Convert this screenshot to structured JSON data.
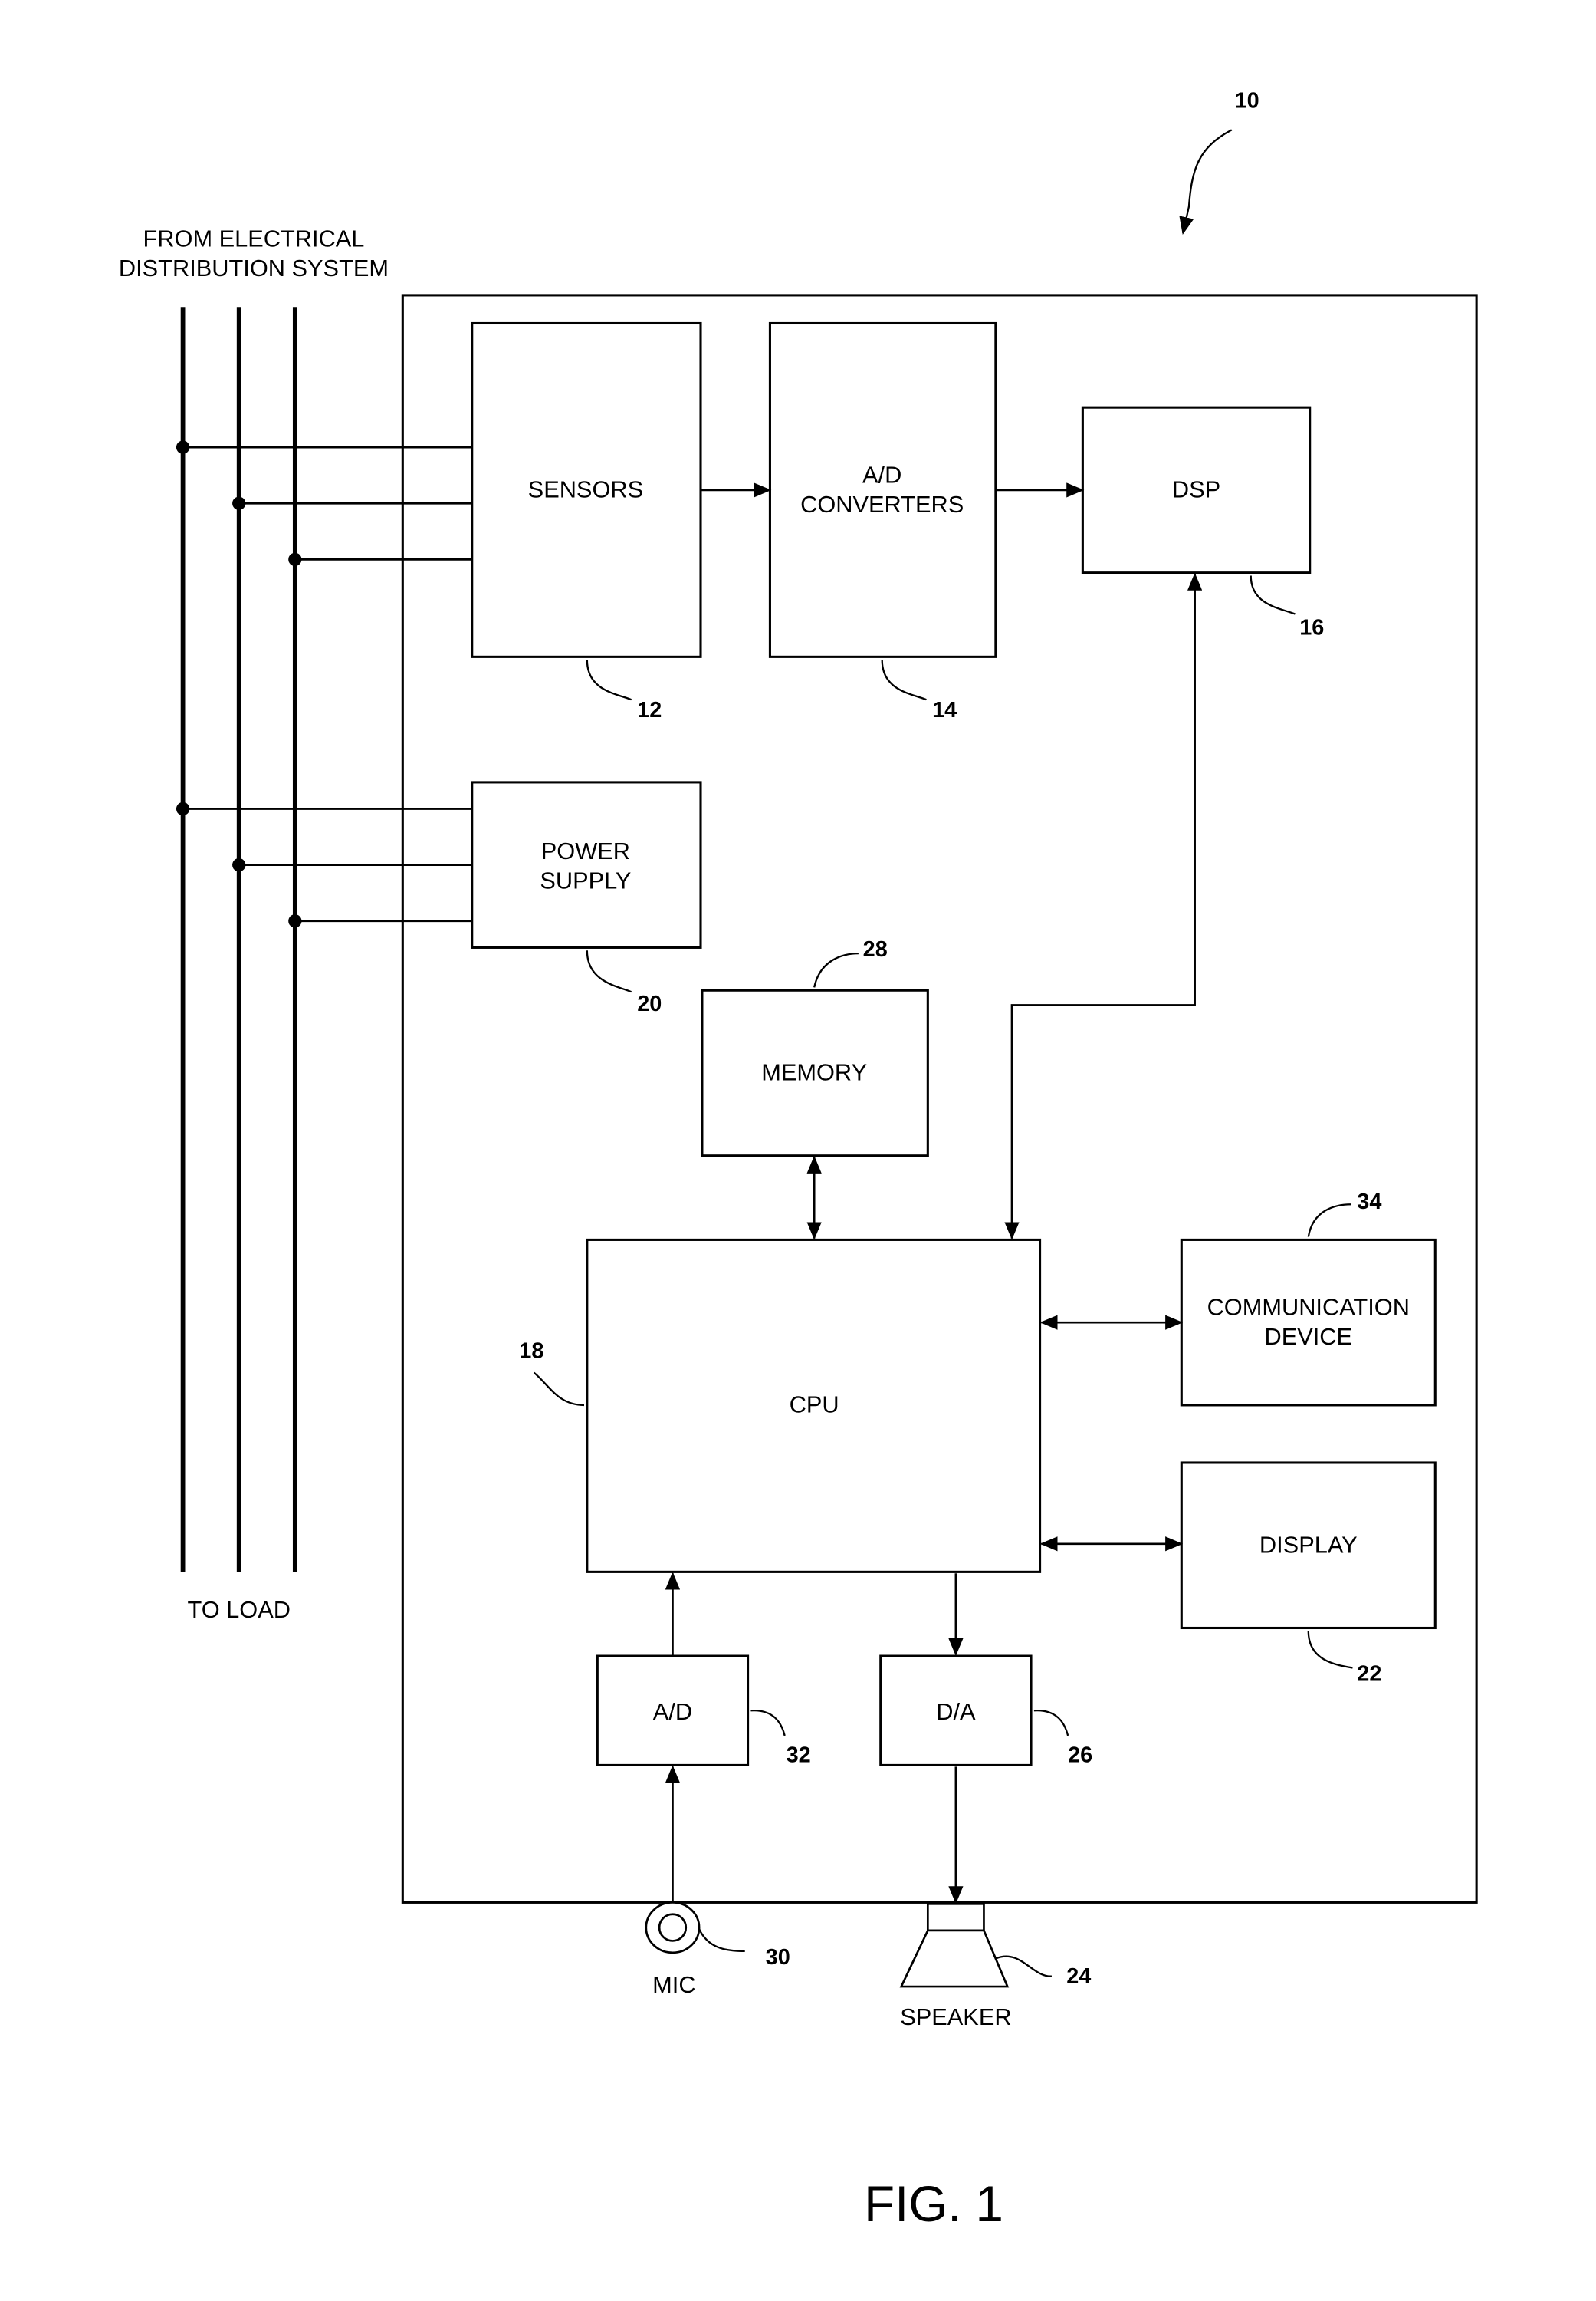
{
  "figure": {
    "label": "FIG. 1",
    "system_ref": "10"
  },
  "lines": {
    "source_label_line1": "FROM ELECTRICAL",
    "source_label_line2": "DISTRIBUTION SYSTEM",
    "load_label": "TO LOAD"
  },
  "blocks": {
    "sensors": {
      "label": "SENSORS",
      "ref": "12"
    },
    "ad_converters": {
      "label_line1": "A/D",
      "label_line2": "CONVERTERS",
      "ref": "14"
    },
    "dsp": {
      "label": "DSP",
      "ref": "16"
    },
    "cpu": {
      "label": "CPU",
      "ref": "18"
    },
    "power_supply": {
      "label_line1": "POWER",
      "label_line2": "SUPPLY",
      "ref": "20"
    },
    "display": {
      "label": "DISPLAY",
      "ref": "22"
    },
    "memory": {
      "label": "MEMORY",
      "ref": "28"
    },
    "communication_device": {
      "label_line1": "COMMUNICATION",
      "label_line2": "DEVICE",
      "ref": "34"
    },
    "ad": {
      "label": "A/D",
      "ref": "32"
    },
    "da": {
      "label": "D/A",
      "ref": "26"
    }
  },
  "peripherals": {
    "mic": {
      "label": "MIC",
      "ref": "30"
    },
    "speaker": {
      "label": "SPEAKER",
      "ref": "24"
    }
  }
}
